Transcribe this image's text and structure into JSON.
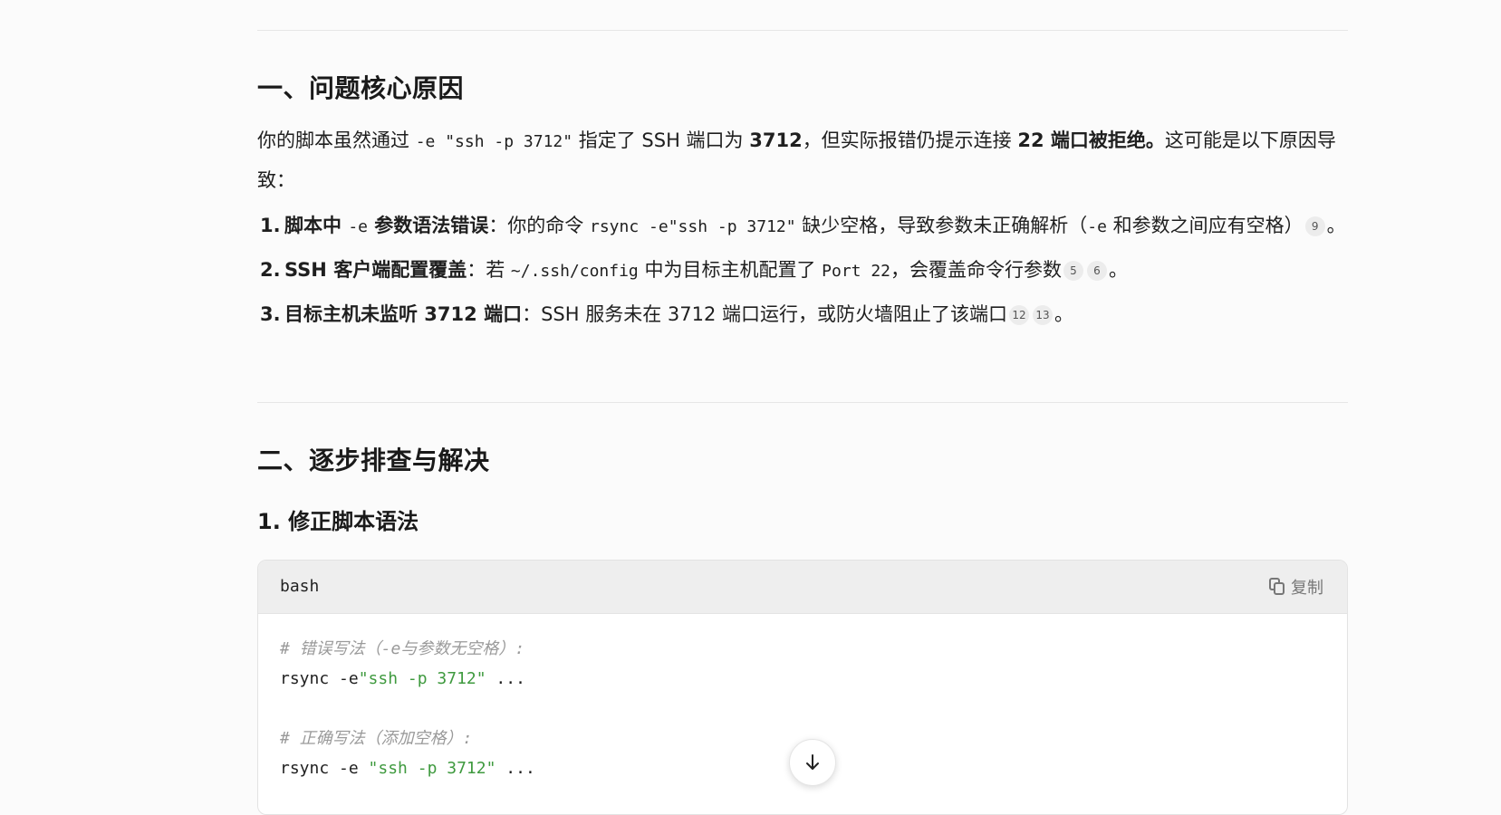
{
  "section1": {
    "title": "一、问题核心原因",
    "para_a": "你的脚本虽然通过 ",
    "para_code1": "-e \"ssh -p 3712\"",
    "para_b": " 指定了 SSH 端口为 ",
    "para_bold1": "3712",
    "para_c": "，但实际报错仍提示连接 ",
    "para_bold2": "22 端口被拒绝。",
    "para_d": "这可能是以下原因导致：",
    "reasons": [
      {
        "num": "1.",
        "bold_a": "脚本中 ",
        "code_a": "-e",
        "bold_b": " 参数语法错误",
        "text_a": "：你的命令 ",
        "code_b": "rsync -e\"ssh -p 3712\"",
        "text_b": " 缺少空格，导致参数未正确解析（",
        "code_c": "-e",
        "text_c": " 和参数之间应有空格）",
        "cites": [
          "9"
        ],
        "end": "。"
      },
      {
        "num": "2.",
        "bold_a": "SSH 客户端配置覆盖",
        "text_a": "：若 ",
        "code_a": "~/.ssh/config",
        "text_b": " 中为目标主机配置了 ",
        "code_b": "Port 22",
        "text_c": "，会覆盖命令行参数",
        "cites": [
          "5",
          "6"
        ],
        "end": "。"
      },
      {
        "num": "3.",
        "bold_a": "目标主机未监听 3712 端口",
        "text_a": "：SSH 服务未在 3712 端口运行，或防火墙阻止了该端口",
        "cites": [
          "12",
          "13"
        ],
        "end": "。"
      }
    ]
  },
  "section2": {
    "title": "二、逐步排查与解决",
    "subtitle": "1. 修正脚本语法",
    "code": {
      "lang": "bash",
      "copy_label": "复制",
      "comment1": "# 错误写法（-e与参数无空格）:",
      "line1_cmd": "rsync -e",
      "line1_str": "\"ssh -p 3712\"",
      "line1_rest": " ...",
      "comment2": "# 正确写法（添加空格）:",
      "line2_cmd": "rsync -e ",
      "line2_str": "\"ssh -p 3712\"",
      "line2_rest": " ..."
    }
  },
  "icons": {
    "copy": "copy-icon",
    "scroll": "arrow-down-icon"
  },
  "colors": {
    "background": "#fbfbfb",
    "code_string": "#3f9a3f",
    "code_comment": "#9a9a9a"
  }
}
